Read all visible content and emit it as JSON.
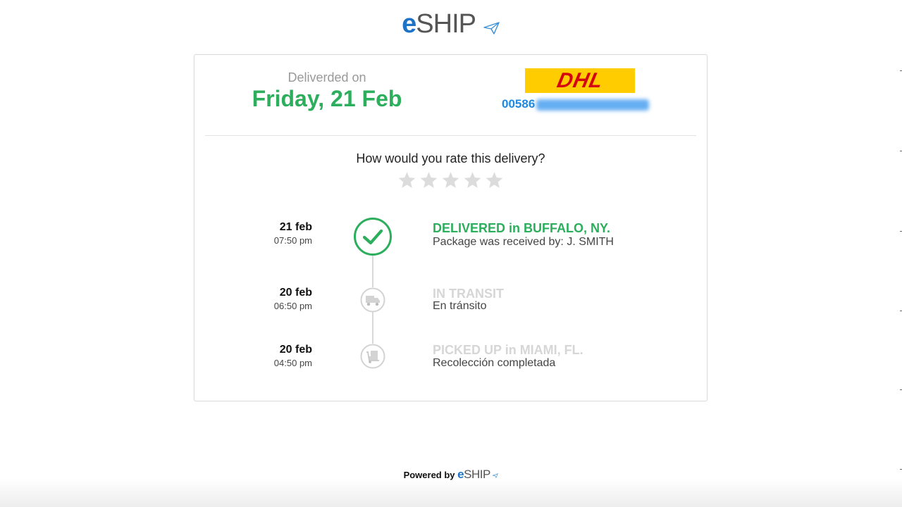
{
  "brand": {
    "logo_e": "e",
    "logo_rest": "SHIP",
    "accent": "#1f73c7"
  },
  "summary": {
    "delivered_label": "Deliverded on",
    "delivered_date": "Friday, 21 Feb",
    "carrier_name": "DHL",
    "tracking_visible": "00586",
    "status_color": "#2cae5d"
  },
  "rating": {
    "question": "How would you rate this delivery?",
    "max_stars": 5,
    "selected": 0
  },
  "timeline": [
    {
      "date": "21 feb",
      "time": "07:50 pm",
      "status": "DELIVERED in BUFFALO, NY.",
      "detail": "Package was received by: J. SMITH",
      "icon": "check-icon",
      "active": true
    },
    {
      "date": "20 feb",
      "time": "06:50 pm",
      "status": "IN TRANSIT",
      "detail": "En tránsito",
      "icon": "truck-icon",
      "active": false
    },
    {
      "date": "20 feb",
      "time": "04:50 pm",
      "status": "PICKED UP in MIAMI, FL.",
      "detail": "Recolección completada",
      "icon": "dolly-icon",
      "active": false
    }
  ],
  "footer": {
    "powered_by": "Powered by",
    "logo_e": "e",
    "logo_rest": "SHIP"
  }
}
